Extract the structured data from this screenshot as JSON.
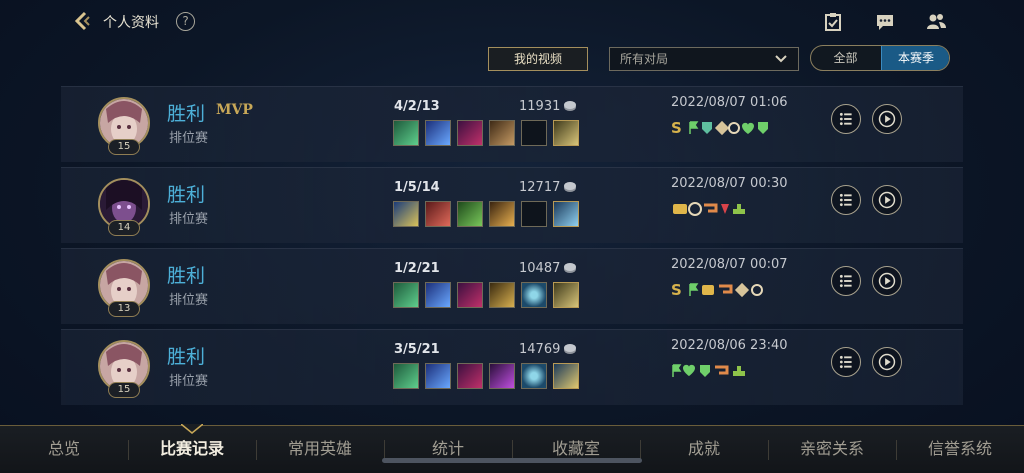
{
  "header": {
    "title": "个人资料",
    "back_icon": "back-chevron-icon",
    "help_icon_text": "?",
    "icons": [
      "tasks-icon",
      "chat-icon",
      "friends-icon"
    ]
  },
  "filters": {
    "my_videos_label": "我的视频",
    "match_filter_value": "所有对局",
    "season_options": [
      "全部",
      "本赛季"
    ],
    "season_selected": "本赛季"
  },
  "matches": [
    {
      "result": "胜利",
      "mvp": "MVP",
      "mode": "排位赛",
      "level": "15",
      "kda": "4/2/13",
      "gold": "11931",
      "datetime": "2022/08/07 01:06",
      "badge_s": "S"
    },
    {
      "result": "胜利",
      "mvp": "",
      "mode": "排位赛",
      "level": "14",
      "kda": "1/5/14",
      "gold": "12717",
      "datetime": "2022/08/07 00:30",
      "badge_s": ""
    },
    {
      "result": "胜利",
      "mvp": "",
      "mode": "排位赛",
      "level": "13",
      "kda": "1/2/21",
      "gold": "10487",
      "datetime": "2022/08/07 00:07",
      "badge_s": "S"
    },
    {
      "result": "胜利",
      "mvp": "",
      "mode": "排位赛",
      "level": "15",
      "kda": "3/5/21",
      "gold": "14769",
      "datetime": "2022/08/06 23:40",
      "badge_s": ""
    }
  ],
  "nav": {
    "tabs": [
      "总览",
      "比赛记录",
      "常用英雄",
      "统计",
      "收藏室",
      "成就",
      "亲密关系",
      "信誉系统"
    ],
    "active_index": 1
  },
  "colors": {
    "win_text": "#4db0d8",
    "gold_accent": "#a48f5d",
    "season_active": "#1a5a86"
  }
}
